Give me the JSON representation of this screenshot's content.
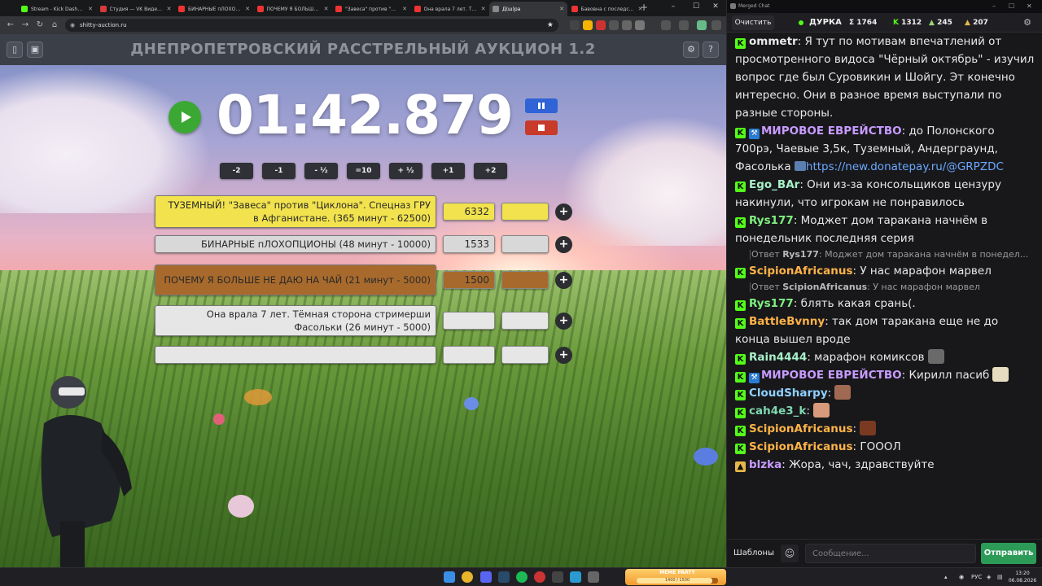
{
  "browser": {
    "tabs": [
      {
        "label": "Stream - Kick Dashbo...",
        "color": "#53fc18"
      },
      {
        "label": "Студия — VK Видео |...",
        "color": "#d73a3a"
      },
      {
        "label": "БИНАРНЫЕ пЛОХОП...",
        "color": "#e33"
      },
      {
        "label": "ПОЧЕМУ Я БОЛЬШЕ ...",
        "color": "#e33"
      },
      {
        "label": "\"Завеса\" против \"Ци...",
        "color": "#e33"
      },
      {
        "label": "Она врала 7 лет. Тём...",
        "color": "#e33"
      },
      {
        "label": "Д(ш)ра",
        "color": "#8a8a8a"
      },
      {
        "label": "Бавовна с последств...",
        "color": "#e33"
      }
    ],
    "url": "shitty-auction.ru"
  },
  "app": {
    "title": "ДНЕПРОПЕТРОВСКИЙ РАССТРЕЛЬНЫЙ АУКЦИОН 1.2",
    "timer": "01:42.879",
    "step_buttons": [
      "-2",
      "-1",
      "- ½",
      "=10",
      "+ ½",
      "+1",
      "+2"
    ],
    "lots": [
      {
        "name": "ТУЗЕМНЫЙ! \"Завеса\" против \"Циклона\". Спецназ ГРУ в Афганистане. (365 минут - 62500)",
        "amount": "6332",
        "color": "#f2e24e",
        "extra_color": "#f2e24e"
      },
      {
        "name": "БИНАРНЫЕ пЛОХОПЦИОНЫ (48 минут - 10000)",
        "amount": "1533",
        "color": "#d8d8d8",
        "extra_color": "#d8d8d8"
      },
      {
        "name": "ПОЧЕМУ Я БОЛЬШЕ НЕ ДАЮ НА ЧАЙ (21 минут - 5000)",
        "amount": "1500",
        "color": "#a86a2c",
        "extra_color": "#a86a2c"
      },
      {
        "name": "Она врала 7 лет. Тёмная сторона стримерши Фасольки (26 минут - 5000)",
        "amount": "",
        "color": "#e6e6e6",
        "extra_color": "#e6e6e6"
      },
      {
        "name": "",
        "amount": "",
        "color": "#e6e6e6",
        "extra_color": "#e6e6e6"
      }
    ],
    "add_symbol": "+"
  },
  "chat": {
    "window_title": "Merged Chat",
    "clear_label": "Очистить",
    "channel": "ДУРКА",
    "stats": {
      "sigma": "Σ 1764",
      "kick": "1312",
      "vk": "245",
      "other": "207"
    },
    "messages": [
      {
        "type": "msg",
        "badges": [
          "kick"
        ],
        "user": "ommetr",
        "color": "#e8e8e8",
        "text": ": Я тут по мотивам впечатлений от просмотренного видоса \"Чёрный октябрь\" - изучил вопрос где был Суровикин и Шойгу. Эт конечно интересно. Они в разное время выступали по разные стороны."
      },
      {
        "type": "msg",
        "badges": [
          "kick",
          "mod"
        ],
        "user": "МИРОВОЕ ЕВРЕЙСТВО",
        "color": "#c89bff",
        "text": ": до Полонского 700рэ, Чаевые 3,5к, Туземный, Андерграунд, Фасолька",
        "link": "https://new.donatepay.ru/@GRPZDC"
      },
      {
        "type": "msg",
        "badges": [
          "kick"
        ],
        "user": "Ego_BAr",
        "color": "#a8f0c8",
        "text": ": Они из-за консольщиков цензуру накинули, что игрокам не понравилось"
      },
      {
        "type": "msg",
        "badges": [
          "kick"
        ],
        "user": "Rys177",
        "color": "#7ff07f",
        "text": ": Моджет дом таракана начнём в понедельник последняя серия"
      },
      {
        "type": "reply",
        "prefix": "Ответ",
        "user": "Rys177",
        "text": ": Моджет дом таракана начнём в понедел..."
      },
      {
        "type": "msg",
        "badges": [
          "kick"
        ],
        "user": "ScipionAfricanus",
        "color": "#ffb347",
        "text": ": У нас марафон марвел"
      },
      {
        "type": "reply",
        "prefix": "Ответ",
        "user": "ScipionAfricanus",
        "text": ": У нас марафон марвел"
      },
      {
        "type": "msg",
        "badges": [
          "kick"
        ],
        "user": "Rys177",
        "color": "#7ff07f",
        "text": ": блять какая срань(."
      },
      {
        "type": "msg",
        "badges": [
          "kick"
        ],
        "user": "BattleBvnny",
        "color": "#ffb347",
        "text": ": так дом таракана еще не до конца вышел вроде"
      },
      {
        "type": "msg",
        "badges": [
          "kick"
        ],
        "user": "Rain4444",
        "color": "#a8f0c8",
        "text": ": марафон комиксов",
        "emote": "#6a6a6a"
      },
      {
        "type": "msg",
        "badges": [
          "kick",
          "mod"
        ],
        "user": "МИРОВОЕ ЕВРЕЙСТВО",
        "color": "#c89bff",
        "text": ": Кирилл пасиб",
        "emote": "#e8dcc0"
      },
      {
        "type": "msg",
        "badges": [
          "kick"
        ],
        "user": "CloudSharpy",
        "color": "#8fd0ff",
        "text": ":",
        "emote": "#a06a52"
      },
      {
        "type": "msg",
        "badges": [
          "kick"
        ],
        "user": "cah4e3_k",
        "color": "#7fd8b0",
        "text": ":",
        "emote": "#d89a7a"
      },
      {
        "type": "msg",
        "badges": [
          "kick"
        ],
        "user": "ScipionAfricanus",
        "color": "#ffb347",
        "text": ":",
        "emote": "#7a3a22"
      },
      {
        "type": "msg",
        "badges": [
          "kick"
        ],
        "user": "ScipionAfricanus",
        "color": "#ffb347",
        "text": ": ГОООЛ"
      },
      {
        "type": "msg",
        "badges": [
          "vk"
        ],
        "user": "blzka",
        "color": "#c89bff",
        "text": ": Жора, чач, здравствуйте"
      }
    ],
    "footer": {
      "templates_label": "Шаблоны",
      "input_placeholder": "Сообщение...",
      "send_label": "Отправить"
    }
  },
  "taskbar": {
    "party_label": "MEME PARTY",
    "party_count": "1400 / 1500",
    "party_progress": 0.93,
    "lang": "РУС",
    "time": "13:20",
    "date": "06.08.2026"
  }
}
